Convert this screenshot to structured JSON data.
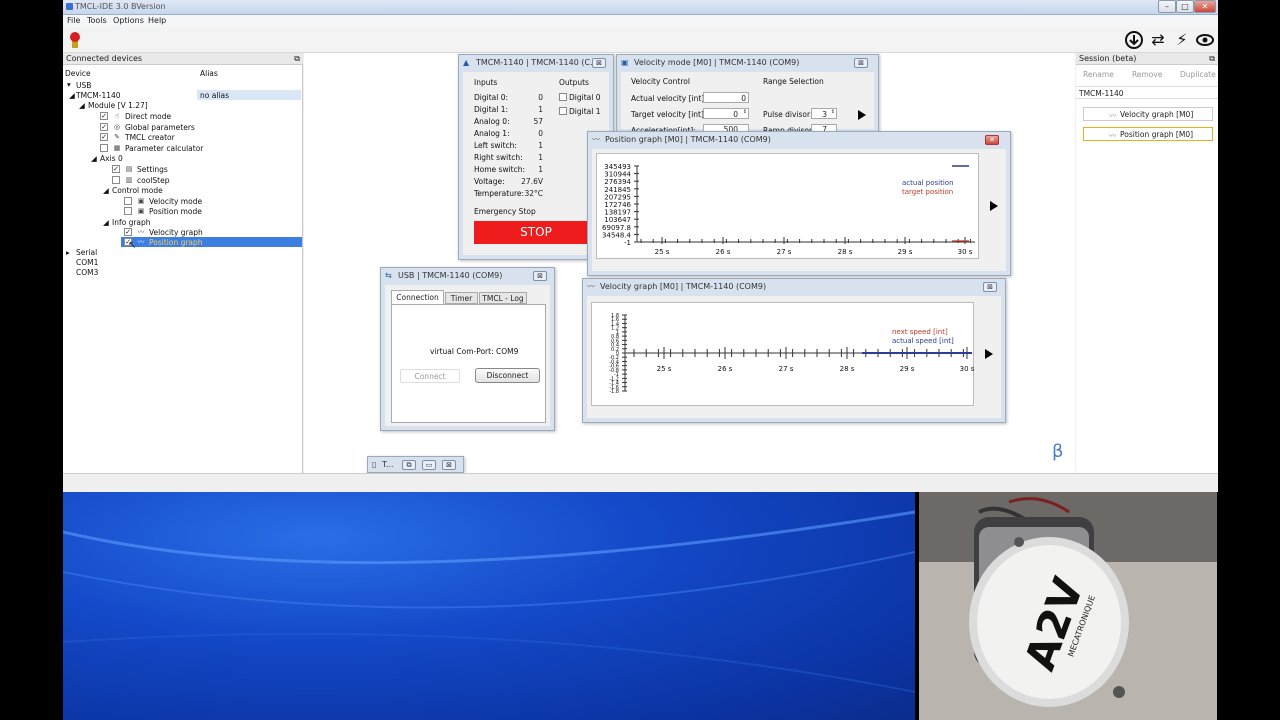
{
  "app_title": "TMCL-IDE 3.0 BVersion",
  "menu": [
    "File",
    "Tools",
    "Options",
    "Help"
  ],
  "connected_devices": {
    "title": "Connected devices",
    "col_device": "Device",
    "col_alias": "Alias",
    "usb": "USB",
    "device": "TMCM-1140",
    "alias": "no alias",
    "module": "Module [V 1.27]",
    "items": [
      "Direct mode",
      "Global parameters",
      "TMCL creator",
      "Parameter calculator"
    ],
    "axis": "Axis 0",
    "axis_items": [
      "Settings",
      "coolStep"
    ],
    "control_mode": "Control mode",
    "control_items": [
      "Velocity mode",
      "Position mode"
    ],
    "info_graph": "Info graph",
    "info_items": [
      "Velocity graph",
      "Position graph"
    ],
    "serial": "Serial",
    "com1": "COM1",
    "com3": "COM3"
  },
  "session": {
    "title": "Session  (beta)",
    "rename": "Rename",
    "remove": "Remove",
    "duplicate": "Duplicate",
    "device": "TMCM-1140",
    "items": [
      "Velocity graph [M0]",
      "Position graph [M0]"
    ]
  },
  "io_window": {
    "title": "TMCM-1140 | TMCM-1140 (C...",
    "inputs": "Inputs",
    "outputs": "Outputs",
    "rows": [
      [
        "Digital 0:",
        "0"
      ],
      [
        "Digital 1:",
        "1"
      ],
      [
        "Analog 0:",
        "57"
      ],
      [
        "Analog 1:",
        "0"
      ],
      [
        "Left switch:",
        "1"
      ],
      [
        "Right switch:",
        "1"
      ],
      [
        "Home switch:",
        "1"
      ],
      [
        "Voltage:",
        "27.6V"
      ],
      [
        "Temperature:",
        "32°C"
      ]
    ],
    "out": [
      "Digital 0",
      "Digital 1"
    ],
    "emergency": "Emergency Stop",
    "stop": "STOP"
  },
  "velmode_window": {
    "title": "Velocity mode [M0] | TMCM-1140 (COM9)",
    "velocity_control": "Velocity Control",
    "range": "Range Selection",
    "actual": "Actual velocity [int]:",
    "actual_val": "0",
    "target": "Target velocity [int]:",
    "target_val": "0",
    "accel": "Acceleration[int]:",
    "accel_val": "500",
    "pulse": "Pulse divisor:",
    "pulse_val": "3",
    "ramp": "Ramp divisor:",
    "ramp_val": "7"
  },
  "posgraph": {
    "title": "Position graph [M0] | TMCM-1140 (COM9)",
    "y_ticks": [
      "345493",
      "310944",
      "276394",
      "241845",
      "207295",
      "172746",
      "138197",
      "103647",
      "69097.8",
      "34548.4",
      "-1"
    ],
    "x_ticks": [
      "25 s",
      "26 s",
      "27 s",
      "28 s",
      "29 s",
      "30 s"
    ],
    "legend": [
      "actual position",
      "target position"
    ]
  },
  "velgraph": {
    "title": "Velocity graph [M0] | TMCM-1140 (COM9)",
    "y_ticks": [
      "1.8",
      "1.6",
      "1.4",
      "1.2",
      "1",
      "0.8",
      "0.6",
      "0.4",
      "0.2",
      "0",
      "-0.2",
      "-0.4",
      "-0.6",
      "-0.8",
      "-1",
      "-1.2",
      "-1.4",
      "-1.6",
      "-1.8"
    ],
    "x_ticks": [
      "25 s",
      "26 s",
      "27 s",
      "28 s",
      "29 s",
      "30 s"
    ],
    "legend": [
      "next speed [int]",
      "actual speed [int]"
    ]
  },
  "usb_window": {
    "title": "USB | TMCM-1140 (COM9)",
    "tabs": [
      "Connection",
      "Timer",
      "TMCL - Log"
    ],
    "port": "virtual Com-Port: COM9",
    "connect": "Connect",
    "disconnect": "Disconnect"
  },
  "minimized": {
    "title": "T..."
  },
  "beta": "β",
  "motor_label": "A2V",
  "motor_sub": "MECATRONIQUE",
  "colors": {
    "stop": "#ee1c1c",
    "selection": "#3d7fe0",
    "legend_blue": "#2b3c9b",
    "legend_red": "#c0392b"
  }
}
